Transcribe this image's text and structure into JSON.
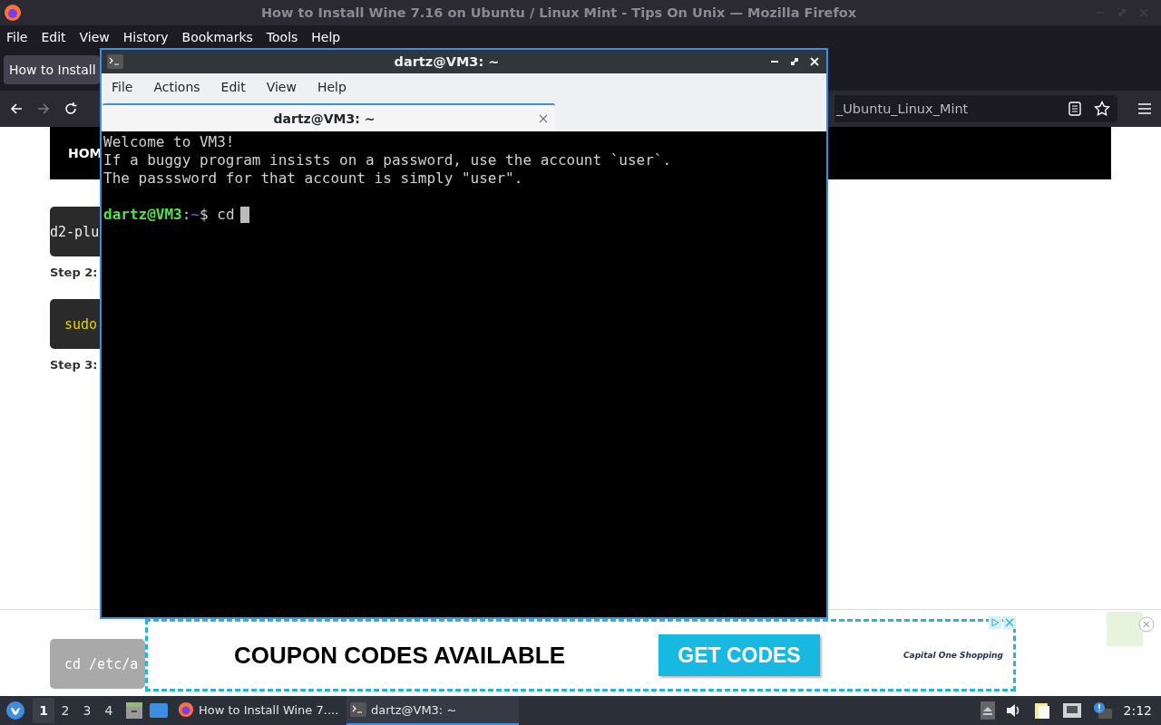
{
  "browser": {
    "title": "How to Install Wine 7.16 on Ubuntu / Linux Mint - Tips On Unix — Mozilla Firefox",
    "menu": [
      "File",
      "Edit",
      "View",
      "History",
      "Bookmarks",
      "Tools",
      "Help"
    ],
    "tab": "How to Install",
    "url": "_Ubuntu_Linux_Mint",
    "page": {
      "nav": "HOM",
      "blocks": [
        {
          "kind": "code",
          "text": "d2-plu"
        },
        {
          "kind": "step",
          "text": "Step 2:"
        },
        {
          "kind": "command",
          "text": "sudo"
        },
        {
          "kind": "step",
          "text": "Step 3:"
        }
      ],
      "faded_code": "cd /etc/a"
    },
    "ad": {
      "headline": "COUPON CODES AVAILABLE",
      "button": "GET CODES",
      "brand": "Capital One Shopping"
    }
  },
  "terminal": {
    "title": "dartz@VM3: ~",
    "menu": [
      "File",
      "Actions",
      "Edit",
      "View",
      "Help"
    ],
    "tab": "dartz@VM3: ~",
    "lines": [
      "Welcome to VM3!",
      "If a buggy program insists on a password, use the account `user`.",
      "The passsword for that account is simply \"user\"."
    ],
    "prompt": {
      "user": "dartz@VM3",
      "separator": ":",
      "path": "~",
      "symbol": "$",
      "command": "cd"
    }
  },
  "taskbar": {
    "workspaces": [
      {
        "label": "1",
        "selected": true
      },
      {
        "label": "2",
        "selected": false
      },
      {
        "label": "3",
        "selected": false
      },
      {
        "label": "4",
        "selected": false
      }
    ],
    "tasks": [
      {
        "kind": "browser",
        "label": "How to Install Wine 7....",
        "selected": false
      },
      {
        "kind": "terminal",
        "label": "dartz@VM3: ~",
        "selected": true
      }
    ],
    "clock": "2:12"
  }
}
